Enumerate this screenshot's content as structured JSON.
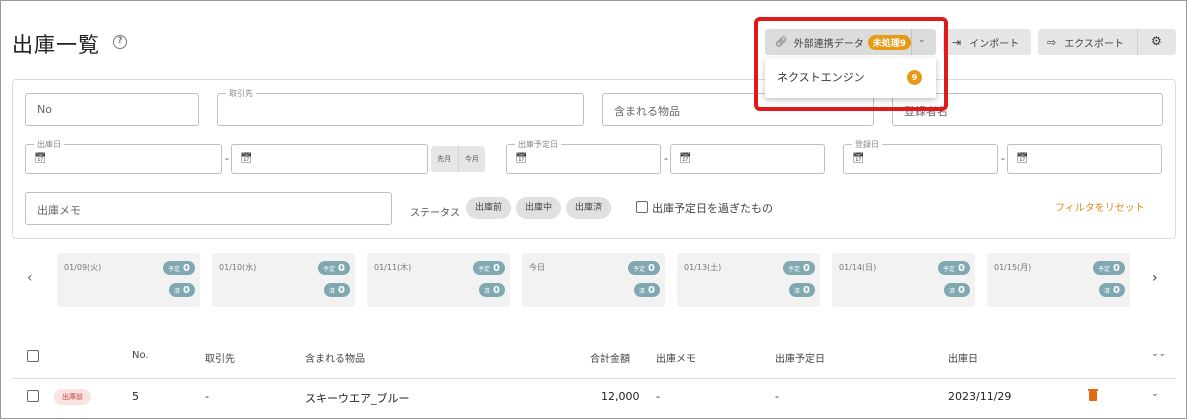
{
  "page": {
    "title": "出庫一覧"
  },
  "toolbar": {
    "external_label": "外部連携データ",
    "external_badge": "未処理9",
    "import_label": "インポート",
    "export_label": "エクスポート"
  },
  "dropdown": {
    "item_label": "ネクストエンジン",
    "item_count": "9"
  },
  "filters": {
    "no_placeholder": "No",
    "client_legend": "取引先",
    "items_placeholder": "含まれる物品",
    "registrant_placeholder": "登録者名",
    "ship_date_legend": "出庫日",
    "planned_date_legend": "出庫予定日",
    "registered_legend": "登録日",
    "last_month": "先月",
    "this_month": "今月",
    "memo_placeholder": "出庫メモ",
    "status_label": "ステータス",
    "chip_before": "出庫前",
    "chip_during": "出庫中",
    "chip_done": "出庫済",
    "overdue_label": "出庫予定日を過ぎたもの",
    "reset_label": "フィルタをリセット",
    "range_dash": "-"
  },
  "calendar": {
    "planned_label": "予定",
    "done_label": "済",
    "days": [
      {
        "label": "01/09(火)",
        "planned": "0",
        "done": "0"
      },
      {
        "label": "01/10(水)",
        "planned": "0",
        "done": "0"
      },
      {
        "label": "01/11(木)",
        "planned": "0",
        "done": "0"
      },
      {
        "label": "今日",
        "planned": "0",
        "done": "0"
      },
      {
        "label": "01/13(土)",
        "planned": "0",
        "done": "0"
      },
      {
        "label": "01/14(日)",
        "planned": "0",
        "done": "0"
      },
      {
        "label": "01/15(月)",
        "planned": "0",
        "done": "0"
      }
    ]
  },
  "table": {
    "columns": [
      "No.",
      "取引先",
      "含まれる物品",
      "合計金額",
      "出庫メモ",
      "出庫予定日",
      "出庫日"
    ],
    "rows": [
      {
        "status": "出庫前",
        "no": "5",
        "client": "-",
        "items": "スキーウエア_ブルー",
        "total": "12,000",
        "memo": "-",
        "planned": "-",
        "date": "2023/11/29"
      }
    ]
  }
}
